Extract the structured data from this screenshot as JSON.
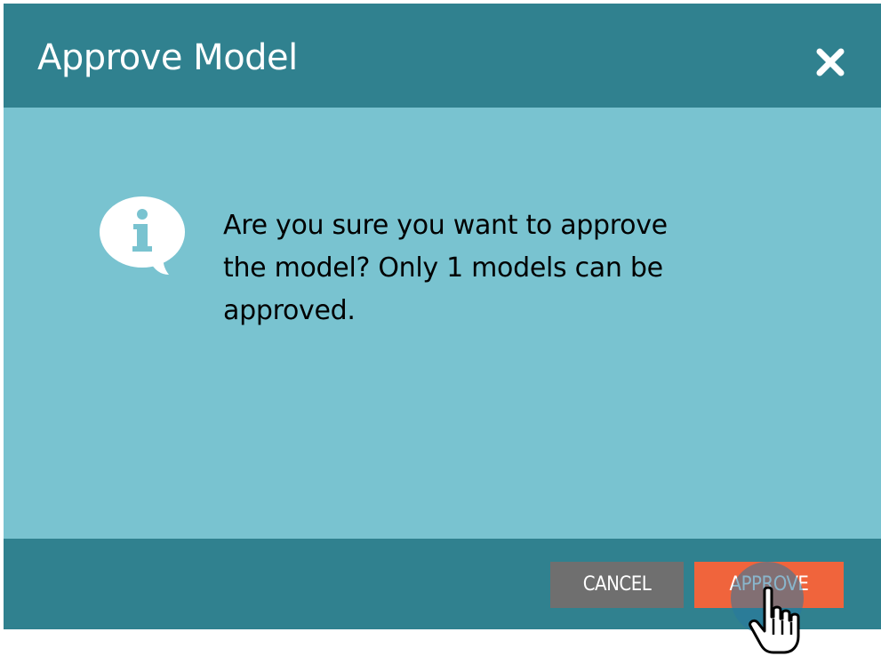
{
  "dialog": {
    "title": "Approve Model",
    "close_icon": "close-icon",
    "info_icon": "info-speech-bubble-icon",
    "message": "Are you sure you want to approve\nthe model?  Only 1 models can be\napproved.",
    "buttons": {
      "cancel_label": "CANCEL",
      "approve_label": "APPROVE"
    }
  },
  "colors": {
    "header": "#30818f",
    "body": "#79c3d0",
    "cancel": "#6f6f6f",
    "approve": "#f0643c"
  },
  "cursor": "hand-pointer-cursor"
}
